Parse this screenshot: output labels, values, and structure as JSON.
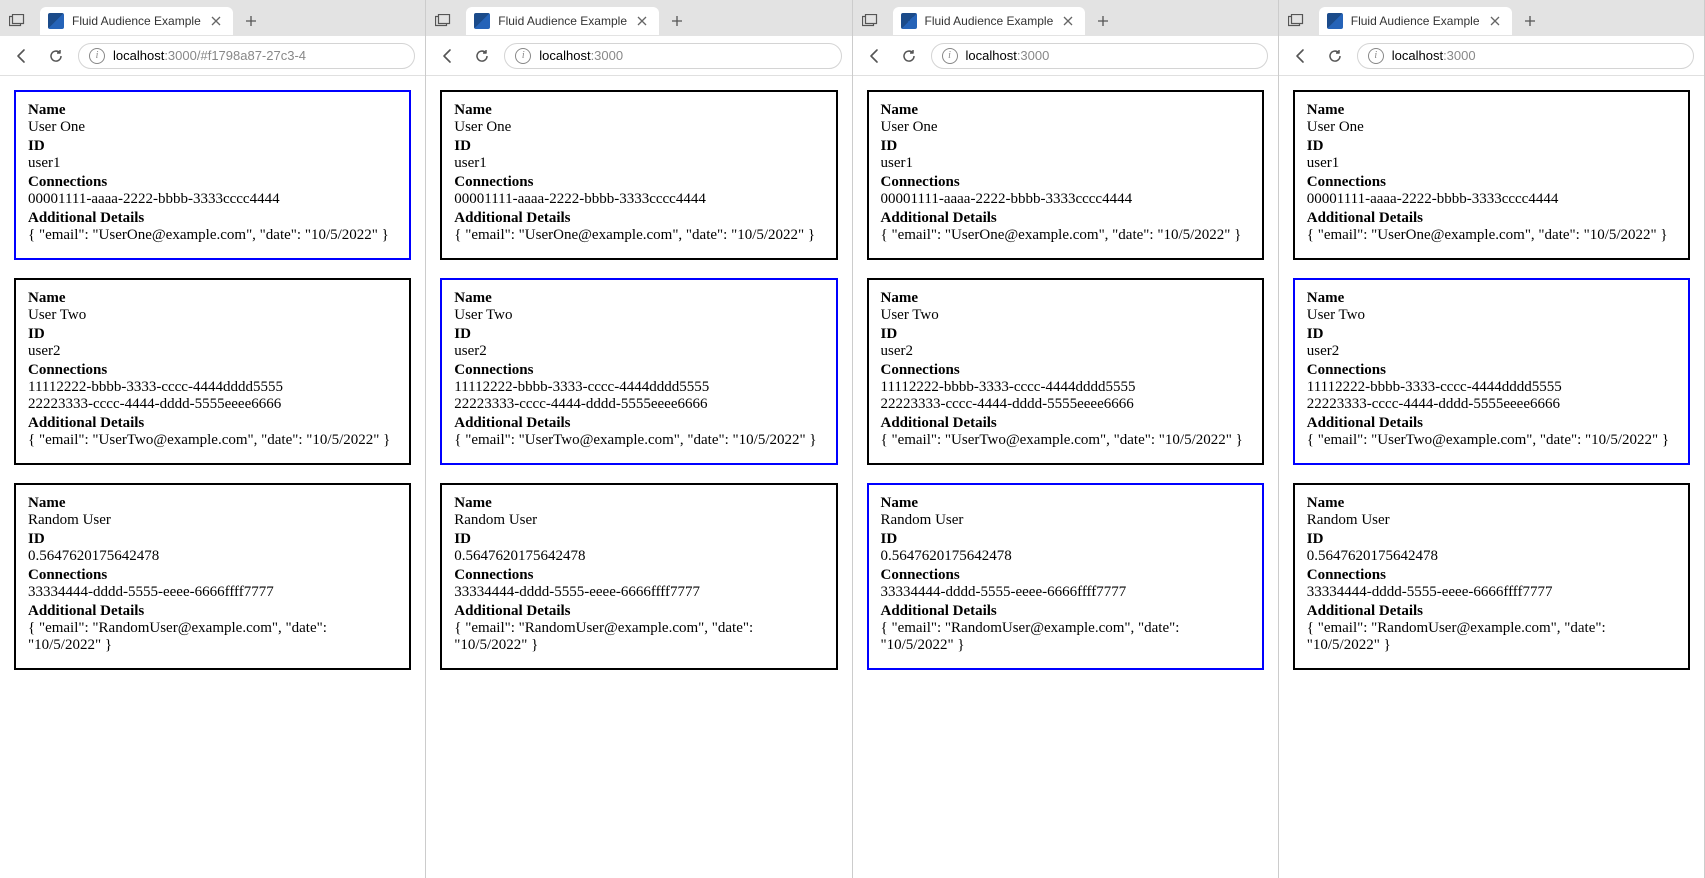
{
  "tab_title": "Fluid Audience Example",
  "labels": {
    "name": "Name",
    "id": "ID",
    "connections": "Connections",
    "details": "Additional Details"
  },
  "users": [
    {
      "name": "User One",
      "id": "user1",
      "connections": [
        "00001111-aaaa-2222-bbbb-3333cccc4444"
      ],
      "details": "{ \"email\": \"UserOne@example.com\", \"date\": \"10/5/2022\" }"
    },
    {
      "name": "User Two",
      "id": "user2",
      "connections": [
        "11112222-bbbb-3333-cccc-4444dddd5555",
        "22223333-cccc-4444-dddd-5555eeee6666"
      ],
      "details": "{ \"email\": \"UserTwo@example.com\", \"date\": \"10/5/2022\" }"
    },
    {
      "name": "Random User",
      "id": "0.5647620175642478",
      "connections": [
        "33334444-dddd-5555-eeee-6666ffff7777"
      ],
      "details": "{ \"email\": \"RandomUser@example.com\", \"date\": \"10/5/2022\" }"
    }
  ],
  "windows": [
    {
      "url_host": "localhost",
      "url_port": ":3000",
      "url_path": "/#f1798a87-27c3-4",
      "active_card": 0
    },
    {
      "url_host": "localhost",
      "url_port": ":3000",
      "url_path": "",
      "active_card": 1
    },
    {
      "url_host": "localhost",
      "url_port": ":3000",
      "url_path": "",
      "active_card": 2
    },
    {
      "url_host": "localhost",
      "url_port": ":3000",
      "url_path": "",
      "active_card": 1
    }
  ]
}
